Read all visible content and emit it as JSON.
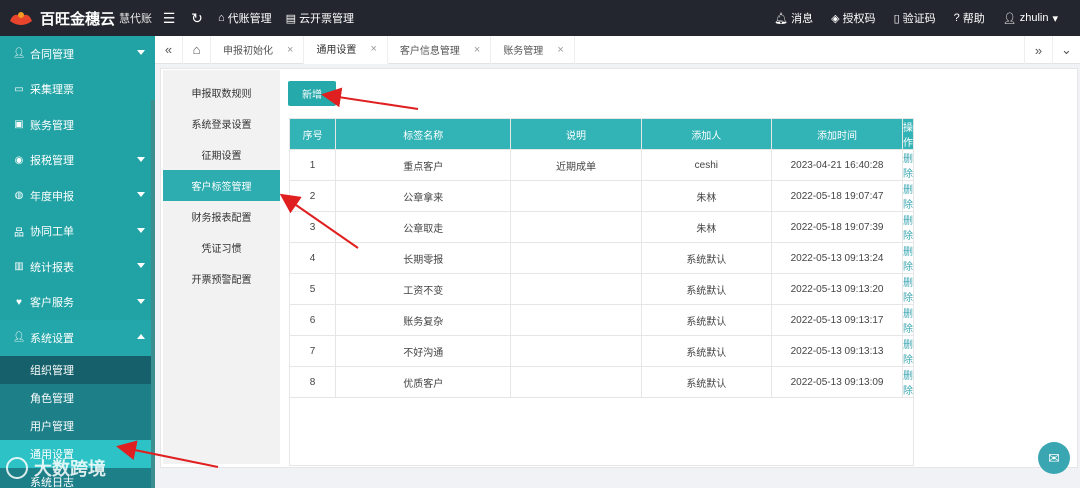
{
  "brand": {
    "name": "百旺金穗云",
    "sub": "慧代账"
  },
  "topnav": {
    "links": [
      {
        "icon": "⌂",
        "label": "代账管理"
      },
      {
        "icon": "▤",
        "label": "云开票管理"
      }
    ]
  },
  "topright": {
    "links": [
      {
        "icon": "🔔",
        "label": "消息"
      },
      {
        "icon": "◈",
        "label": "授权码"
      },
      {
        "icon": "▯",
        "label": "验证码"
      },
      {
        "icon": "?",
        "label": "帮助"
      }
    ],
    "user": "zhulin"
  },
  "sidebar": {
    "items": [
      {
        "label": "合同管理",
        "caret": "down"
      },
      {
        "label": "采集理票",
        "caret": ""
      },
      {
        "label": "账务管理",
        "caret": ""
      },
      {
        "label": "报税管理",
        "caret": "down"
      },
      {
        "label": "年度申报",
        "caret": "down"
      },
      {
        "label": "协同工单",
        "caret": "down"
      },
      {
        "label": "统计报表",
        "caret": "down"
      },
      {
        "label": "客户服务",
        "caret": "down"
      },
      {
        "label": "系统设置",
        "caret": "up"
      }
    ],
    "subitems": [
      {
        "label": "组织管理"
      },
      {
        "label": "角色管理"
      },
      {
        "label": "用户管理"
      },
      {
        "label": "通用设置"
      },
      {
        "label": "系统日志"
      }
    ]
  },
  "tabs": [
    {
      "label": "申报初始化"
    },
    {
      "label": "通用设置"
    },
    {
      "label": "客户信息管理"
    },
    {
      "label": "账务管理"
    }
  ],
  "submenu": [
    "申报取数规则",
    "系统登录设置",
    "征期设置",
    "客户标签管理",
    "财务报表配置",
    "凭证习惯",
    "开票预警配置"
  ],
  "add_button": "新增",
  "table": {
    "headers": [
      "序号",
      "标签名称",
      "说明",
      "添加人",
      "添加时间",
      "操作"
    ],
    "rows": [
      [
        "1",
        "重点客户",
        "近期成单",
        "ceshi",
        "2023-04-21 16:40:28",
        "删除"
      ],
      [
        "2",
        "公章拿来",
        "",
        "朱林",
        "2022-05-18 19:07:47",
        "删除"
      ],
      [
        "3",
        "公章取走",
        "",
        "朱林",
        "2022-05-18 19:07:39",
        "删除"
      ],
      [
        "4",
        "长期零报",
        "",
        "系统默认",
        "2022-05-13 09:13:24",
        "删除"
      ],
      [
        "5",
        "工资不变",
        "",
        "系统默认",
        "2022-05-13 09:13:20",
        "删除"
      ],
      [
        "6",
        "账务复杂",
        "",
        "系统默认",
        "2022-05-13 09:13:17",
        "删除"
      ],
      [
        "7",
        "不好沟通",
        "",
        "系统默认",
        "2022-05-13 09:13:13",
        "删除"
      ],
      [
        "8",
        "优质客户",
        "",
        "系统默认",
        "2022-05-13 09:13:09",
        "删除"
      ]
    ]
  },
  "watermark": "大数跨境",
  "colors": {
    "accent": "#26a9ab",
    "topbar": "#23262e",
    "arrow": "#e02020"
  }
}
